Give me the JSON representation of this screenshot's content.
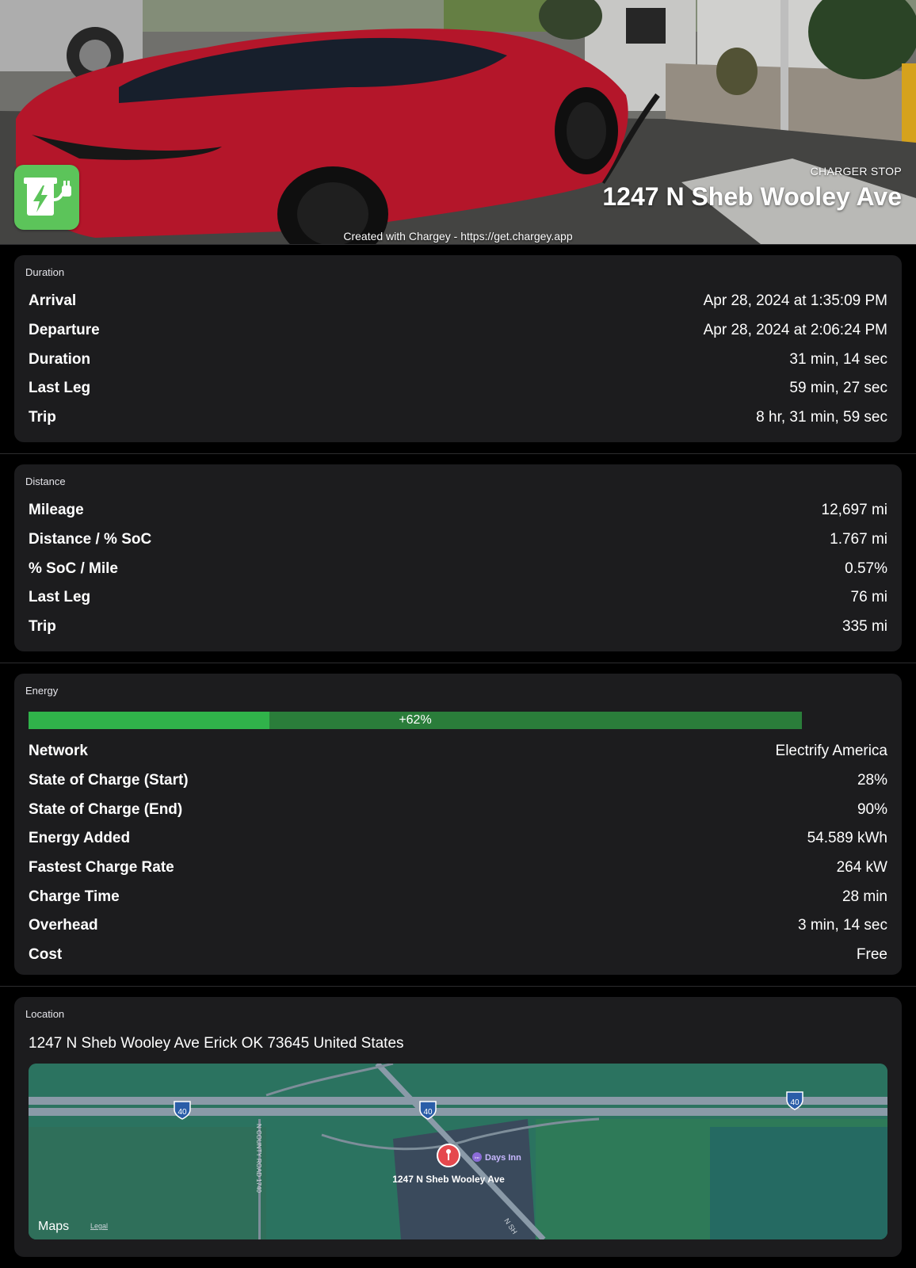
{
  "hero": {
    "kicker": "CHARGER STOP",
    "title": "1247 N Sheb Wooley Ave",
    "credit": "Created with Chargey - https://get.chargey.app",
    "app_icon": "ev-plug-icon",
    "accent": "#5cc45a"
  },
  "duration": {
    "title": "Duration",
    "rows": [
      {
        "label": "Arrival",
        "value": "Apr 28, 2024 at 1:35:09 PM"
      },
      {
        "label": "Departure",
        "value": "Apr 28, 2024 at 2:06:24 PM"
      },
      {
        "label": "Duration",
        "value": "31 min, 14 sec"
      },
      {
        "label": "Last Leg",
        "value": "59 min, 27 sec"
      },
      {
        "label": "Trip",
        "value": "8 hr, 31 min, 59 sec"
      }
    ]
  },
  "distance": {
    "title": "Distance",
    "rows": [
      {
        "label": "Mileage",
        "value": "12,697 mi"
      },
      {
        "label": "Distance / % SoC",
        "value": "1.767 mi"
      },
      {
        "label": "% SoC / Mile",
        "value": "0.57%"
      },
      {
        "label": "Last Leg",
        "value": "76 mi"
      },
      {
        "label": "Trip",
        "value": "335 mi"
      }
    ]
  },
  "energy": {
    "title": "Energy",
    "bar": {
      "label": "+62%",
      "start_fraction": 0.28,
      "end_fraction": 0.9,
      "start_color": "#30b34a",
      "added_color": "#2a7d3a"
    },
    "rows": [
      {
        "label": "Network",
        "value": "Electrify America"
      },
      {
        "label": "State of Charge (Start)",
        "value": "28%"
      },
      {
        "label": "State of Charge (End)",
        "value": "90%"
      },
      {
        "label": "Energy Added",
        "value": "54.589 kWh"
      },
      {
        "label": "Fastest Charge Rate",
        "value": "264 kW"
      },
      {
        "label": "Charge Time",
        "value": "28 min"
      },
      {
        "label": "Overhead",
        "value": "3 min, 14 sec"
      },
      {
        "label": "Cost",
        "value": "Free"
      }
    ]
  },
  "location": {
    "title": "Location",
    "address": "1247 N Sheb Wooley Ave Erick OK 73645 United States",
    "map": {
      "pin_label": "1247 N Sheb Wooley Ave",
      "poi_label": "Days Inn",
      "poi_badge": "Inn",
      "highway_shield": "40",
      "county_road": "N COUNTY ROAD 1740",
      "street_label": "N SH",
      "brand": "Maps",
      "legal": "Legal"
    }
  }
}
